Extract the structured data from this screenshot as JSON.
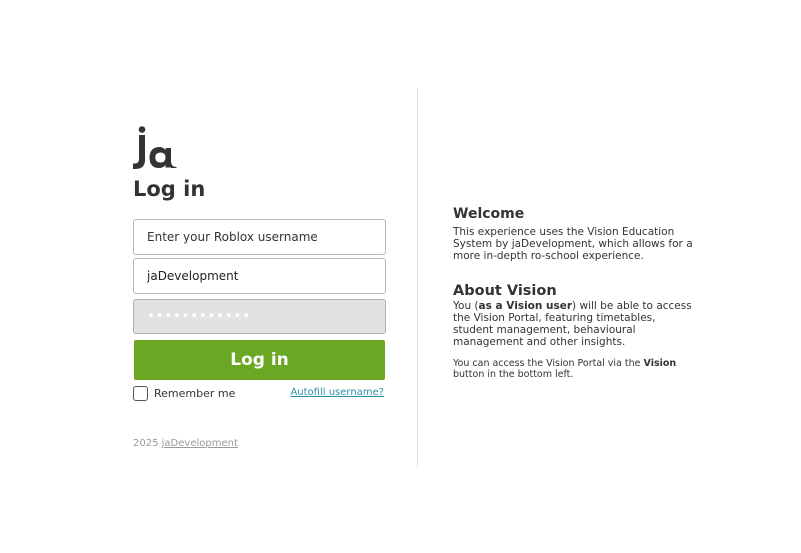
{
  "login": {
    "logo_text": "ja",
    "title": "Log in",
    "username_placeholder": "Enter your Roblox username",
    "username_value": "jaDevelopment",
    "password_value": "••••••••••••",
    "login_button": "Log in",
    "remember_label": "Remember me",
    "remember_checked": false,
    "autofill_link": "Autofill username?",
    "footer_year": "2025",
    "footer_link": "jaDevelopment"
  },
  "info": {
    "welcome_title": "Welcome",
    "welcome_text": "This experience uses the Vision Education System by jaDevelopment, which allows for a more in-depth ro-school experience.",
    "about_title": "About Vision",
    "about_prefix": "You (",
    "about_bold": "as a Vision user",
    "about_suffix": ") will be able to access the Vision Portal, featuring timetables, student management, behavioural management and other insights.",
    "access_prefix": "You can access the Vision Portal via the ",
    "access_bold": "Vision",
    "access_suffix": " button in the bottom left."
  },
  "colors": {
    "accent_green": "#6aa824",
    "link_teal": "#2f8fa6",
    "divider": "#dddddd",
    "password_bg": "#e2e2e2"
  }
}
